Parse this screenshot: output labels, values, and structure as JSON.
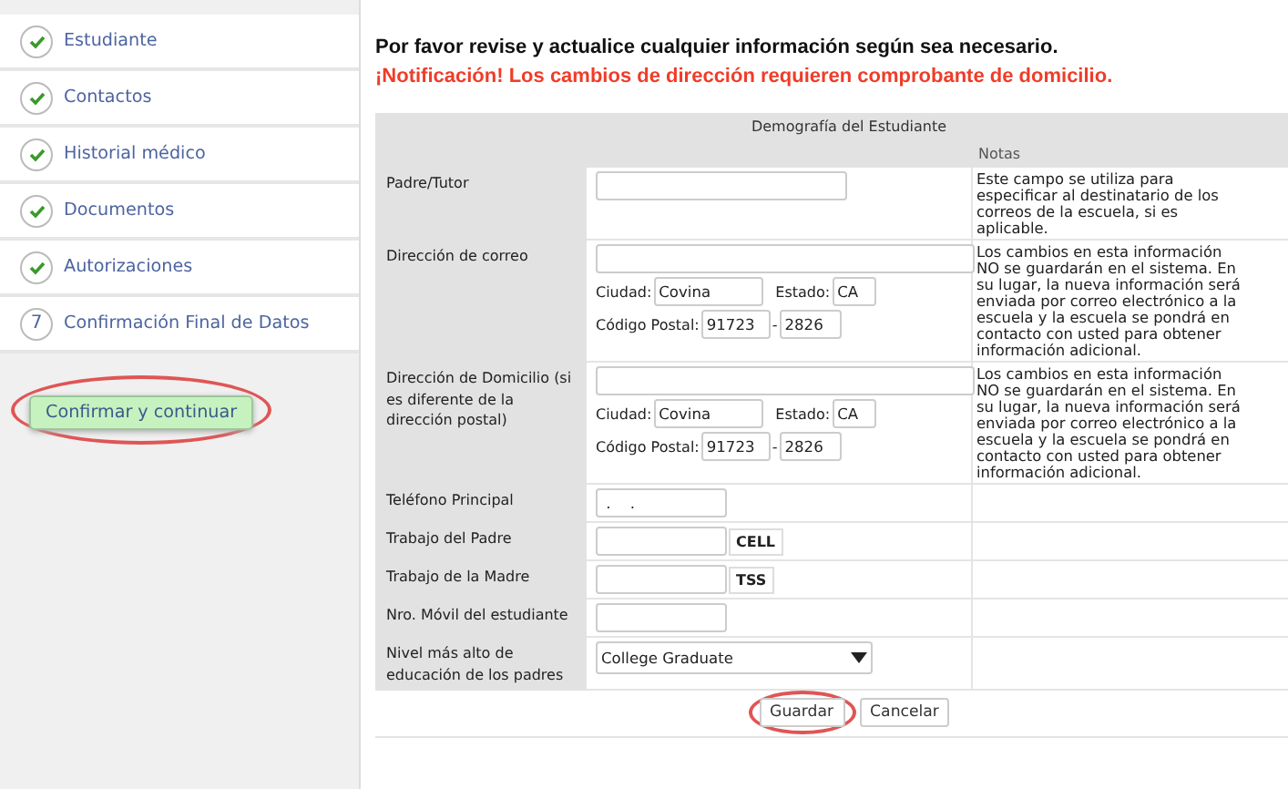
{
  "sidebar": {
    "steps": [
      {
        "label": "Estudiante",
        "completed": true
      },
      {
        "label": "Contactos",
        "completed": true
      },
      {
        "label": "Historial médico",
        "completed": true
      },
      {
        "label": "Documentos",
        "completed": true
      },
      {
        "label": "Autorizaciones",
        "completed": true
      },
      {
        "label": "Confirmación Final de Datos",
        "completed": false,
        "number": "7"
      }
    ],
    "confirm_button": {
      "label": "Confirmar y continuar",
      "highlighted": true
    }
  },
  "main": {
    "instruction": "Por favor revise y actualice cualquier información según sea necesario.",
    "notice": "¡Notificación! Los cambios de dirección requieren comprobante de domicilio.",
    "form": {
      "title": "Demografía del Estudiante",
      "notes_heading": "Notas",
      "rows": [
        {
          "kind": "text",
          "label": "Padre/Tutor",
          "value": "",
          "notes": [
            "Este campo se utiliza para",
            "especificar al destinatario de los",
            "correos de la escuela, si es",
            "aplicable."
          ]
        },
        {
          "kind": "address",
          "label": "Dirección de correo",
          "street": "",
          "city_label": "Ciudad:",
          "city": "Covina",
          "state_label": "Estado:",
          "state": "CA",
          "zip_label": "Código Postal:",
          "zip": "91723",
          "zip_sep": "-",
          "zip4": "2826",
          "notes": [
            "Los cambios en esta información",
            "NO se guardarán en el sistema. En",
            "su lugar, la nueva información será",
            "enviada por correo electrónico a la",
            "escuela y la escuela se pondrá en",
            "contacto con usted para obtener",
            "información adicional."
          ]
        },
        {
          "kind": "address",
          "label": "Dirección de Domicilio (si es diferente de la dirección postal)",
          "street": "",
          "city_label": "Ciudad:",
          "city": "Covina",
          "state_label": "Estado:",
          "state": "CA",
          "zip_label": "Código Postal:",
          "zip": "91723",
          "zip_sep": "-",
          "zip4": "2826",
          "notes": [
            "Los cambios en esta información",
            "NO se guardarán en el sistema. En",
            "su lugar, la nueva información será",
            "enviada por correo electrónico a la",
            "escuela y la escuela se pondrá en",
            "contacto con usted para obtener",
            "información adicional."
          ]
        },
        {
          "kind": "text",
          "label": "Teléfono Principal",
          "value": " .    .",
          "notes": []
        },
        {
          "kind": "suffix",
          "label": "Trabajo del Padre",
          "value": "",
          "suffix": "CELL",
          "notes": []
        },
        {
          "kind": "suffix",
          "label": "Trabajo de la Madre",
          "value": "",
          "suffix": "TSS",
          "notes": []
        },
        {
          "kind": "text",
          "label": "Nro. Móvil del estudiante",
          "value": "",
          "notes": []
        },
        {
          "kind": "select",
          "label": "Nivel más alto de educación de los padres",
          "value": "College Graduate",
          "notes": []
        }
      ],
      "buttons": [
        {
          "label": "Guardar",
          "highlighted": true
        },
        {
          "label": "Cancelar",
          "highlighted": false
        }
      ]
    }
  }
}
